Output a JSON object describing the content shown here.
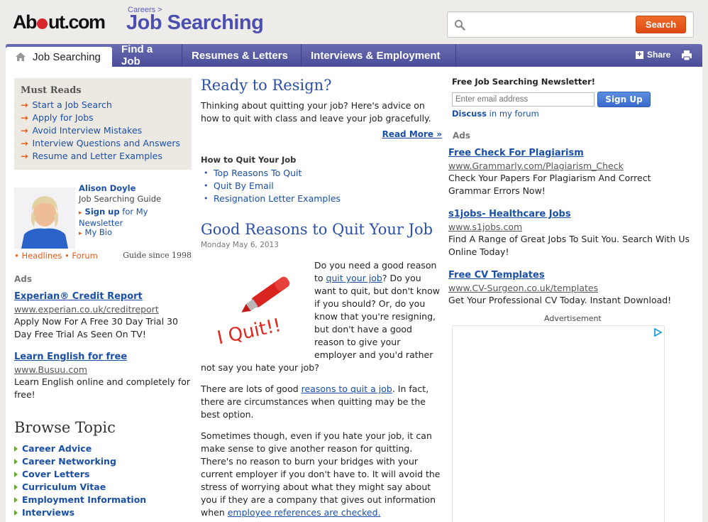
{
  "header": {
    "logo_text_1": "Ab",
    "logo_text_2": "ut.com",
    "breadcrumb": "Careers >",
    "site_title": "Job Searching",
    "search_placeholder": "",
    "search_button": "Search"
  },
  "nav": {
    "tabs": [
      {
        "label": "Job Searching"
      },
      {
        "label": "Find a Job"
      },
      {
        "label": "Resumes & Letters"
      },
      {
        "label": "Interviews & Employment"
      }
    ],
    "share_label": "Share"
  },
  "must_reads": {
    "title": "Must Reads",
    "items": [
      "Start a Job Search",
      "Apply for Jobs",
      "Avoid Interview Mistakes",
      "Interview Questions and Answers",
      "Resume and Letter Examples"
    ]
  },
  "guide": {
    "name": "Alison Doyle",
    "role": "Job Searching Guide",
    "signup_bold": "Sign up",
    "signup_rest": "for My Newsletter",
    "bio": "My Bio",
    "headlines": "Headlines",
    "forum": "Forum",
    "since": "Guide since 1998"
  },
  "left_ads": {
    "label": "Ads",
    "items": [
      {
        "title": "Experian® Credit Report",
        "url": "www.experian.co.uk/creditreport",
        "desc": "Apply Now For A Free 30 Day Trial 30 Day Free Trial As Seen On TV!"
      },
      {
        "title": "Learn English for free",
        "url": "www.Busuu.com",
        "desc": "Learn English online and completely for free!"
      }
    ]
  },
  "browse": {
    "title": "Browse Topic",
    "items": [
      "Career Advice",
      "Career Networking",
      "Cover Letters",
      "Curriculum Vitae",
      "Employment Information",
      "Interviews"
    ]
  },
  "feature": {
    "title": "Ready to Resign?",
    "desc": "Thinking about quitting your job? Here's advice on how to quit with class and leave your job gracefully.",
    "read_more": "Read More »",
    "how_title": "How to Quit Your Job",
    "how_items": [
      "Top Reasons To Quit",
      "Quit By Email",
      "Resignation Letter Examples"
    ]
  },
  "article": {
    "title": "Good Reasons to Quit Your Job",
    "date": "Monday May 6, 2013",
    "image_text": "I Quit!!",
    "p1_a": "Do you need a good reason to ",
    "p1_link": "quit your job",
    "p1_b": "? Do you want to quit, but don't know if you should? Or, do you know that you're resigning, but don't have a good reason to give your employer and you'd rather not say you hate your job?",
    "p2_a": "There are lots of good ",
    "p2_link": "reasons to quit a job",
    "p2_b": ". In fact, there are circumstances when quitting may be the best option.",
    "p3_a": "Sometimes though, even if you hate your job, it can make sense to give another reason for quitting. There's no reason to burn your bridges with your current employer if you don't have to. It will avoid the stress of worrying about what they might say about you if they are a company that gives out information when ",
    "p3_link": "employee references are checked."
  },
  "newsletter": {
    "title": "Free Job Searching Newsletter!",
    "placeholder": "Enter email address",
    "button": "Sign Up",
    "discuss_bold": "Discuss",
    "discuss_rest": " in my forum"
  },
  "right_ads": {
    "label": "Ads",
    "items": [
      {
        "title": "Free Check For Plagiarism",
        "url": "www.Grammarly.com/Plagiarism_Check",
        "desc": "Check Your Papers For Plagiarism And Correct Grammar Errors Now!"
      },
      {
        "title": "s1jobs- Healthcare Jobs",
        "url": "www.s1jobs.com",
        "desc": "Find A Range of Great Jobs To Suit You. Search With Us Online Today!"
      },
      {
        "title": "Free CV Templates",
        "url": "www.CV-Surgeon.co.uk/templates",
        "desc": "Get Your Professional CV Today. Instant Download!"
      }
    ],
    "advertisement_label": "Advertisement"
  }
}
